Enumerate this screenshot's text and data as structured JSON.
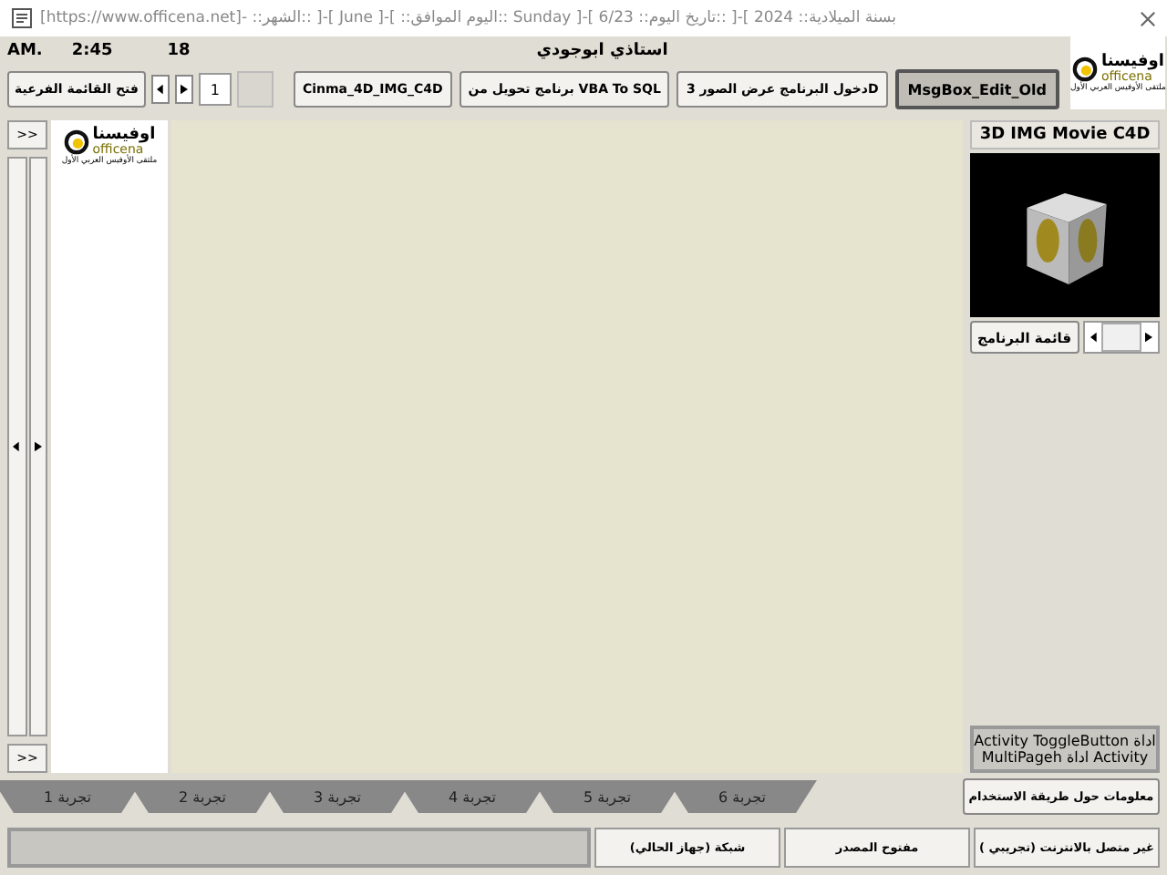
{
  "window": {
    "title": "بسنة الميلادية:: 2024 ]-[ ::تاريخ اليوم:: 6/23 ]-[ Sunday ::اليوم الموافق:: ]-[ June ]-[ ::الشهر:: -[https://www.officena.net]"
  },
  "header": {
    "period": "AM.",
    "time": "2:45",
    "day": "18",
    "user": "استاذي ابوجودي"
  },
  "toolbar": {
    "submenu_button": "فتح القائمة الفرعية",
    "page_number": "1",
    "buttons": [
      {
        "label": "MsgBox_Edit_Old",
        "selected": true
      },
      {
        "label": "دخول البرنامج عرض الصور 3D",
        "selected": false
      },
      {
        "label": "برنامج تحويل من  VBA To SQL",
        "selected": false
      },
      {
        "label": "Cinma_4D_IMG_C4D",
        "selected": false
      }
    ]
  },
  "logo": {
    "name": "اوفيسنا",
    "latin": "officena",
    "tagline": "ملتقى الأوفيس العربي الأول"
  },
  "panel_logo": {
    "name": "اوفيسنا",
    "latin": "officena",
    "tagline": "ملتقى الأوفيس العربي الأول"
  },
  "left_panel": {
    "top_button": ">>",
    "bottom_button": ">>"
  },
  "side_panel": {
    "title": "3D IMG Movie C4D",
    "menu_button": "قائمة البرنامج",
    "notes": [
      "Activity  ToggleButton اداة",
      "MultiPageh اداة  Activity"
    ]
  },
  "tabs": [
    {
      "label": "تجربة 6",
      "selected": false
    },
    {
      "label": "تجربة 5",
      "selected": false
    },
    {
      "label": "تجربة 4",
      "selected": false
    },
    {
      "label": "تجربة 3",
      "selected": false
    },
    {
      "label": "تجربة 2",
      "selected": false
    },
    {
      "label": "تجربة 1",
      "selected": false
    }
  ],
  "help_button": "معلومات حول طريقة الاستخدام",
  "status_bar": [
    "غير متصل بالانترنت (تجريبي )",
    "مفتوح المصدر",
    "شبكة (جهاز الحالي)"
  ]
}
